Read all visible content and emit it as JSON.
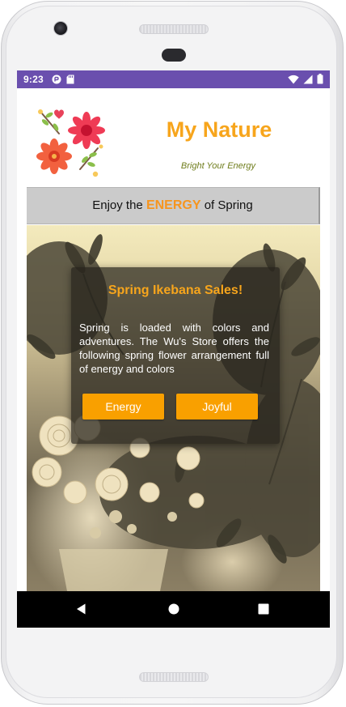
{
  "status_bar": {
    "time": "9:23",
    "background": "#6a4fae",
    "left_icons": [
      "app-notification-icon",
      "sd-card-icon"
    ],
    "right_icons": [
      "wifi-icon",
      "cellular-signal-icon",
      "battery-icon"
    ]
  },
  "header": {
    "title": "My Nature",
    "subtitle": "Bright Your Energy",
    "title_color": "#f7a51c",
    "subtitle_color": "#6f7d1c",
    "logo_icon": "flowers-logo-icon"
  },
  "banner": {
    "prefix": "Enjoy the",
    "highlight": "ENERGY",
    "suffix": "of Spring",
    "highlight_color": "#f7951e",
    "background": "#cbcbcb"
  },
  "card": {
    "title": "Spring Ikebana Sales!",
    "body": "Spring is loaded with colors and adventures. The Wu's Store offers the following spring flower arrangement full of energy and colors",
    "buttons": [
      {
        "label": "Energy"
      },
      {
        "label": "Joyful"
      }
    ],
    "button_color": "#f9a000"
  },
  "nav_bar": {
    "icons": [
      "back-icon",
      "home-icon",
      "recents-icon"
    ]
  }
}
